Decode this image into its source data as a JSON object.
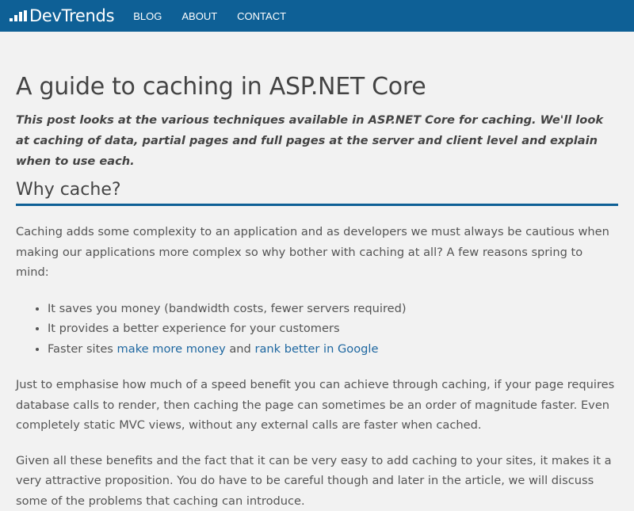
{
  "colors": {
    "navbar_bg": "#0e6096",
    "page_bg": "#f2f2f2",
    "heading_rule": "#0e6096",
    "link": "#1e67a0"
  },
  "navbar": {
    "brand": "DevTrends",
    "brand_icon": "bar-signal-icon",
    "links": [
      "BLOG",
      "ABOUT",
      "CONTACT"
    ]
  },
  "article": {
    "title": "A guide to caching in ASP.NET Core",
    "lead": "This post looks at the various techniques available in ASP.NET Core for caching. We'll look at caching of data, partial pages and full pages at the server and client level and explain when to use each.",
    "section_heading": "Why cache?",
    "intro_paragraph": "Caching adds some complexity to an application and as developers we must always be cautious when making our applications more complex so why bother with caching at all? A few reasons spring to mind:",
    "bullets": {
      "item1": "It saves you money (bandwidth costs, fewer servers required)",
      "item2": "It provides a better experience for your customers",
      "item3_prefix": "Faster sites ",
      "item3_link1": "make more money",
      "item3_middle": " and ",
      "item3_link2": "rank better in Google"
    },
    "paragraph2": "Just to emphasise how much of a speed benefit you can achieve through caching, if your page requires database calls to render, then caching the page can sometimes be an order of magnitude faster. Even completely static MVC views, without any external calls are faster when cached.",
    "paragraph3": "Given all these benefits and the fact that it can be very easy to add caching to your sites, it makes it a very attractive proposition. You do have to be careful though and later in the article, we will discuss some of the problems that caching can introduce."
  }
}
